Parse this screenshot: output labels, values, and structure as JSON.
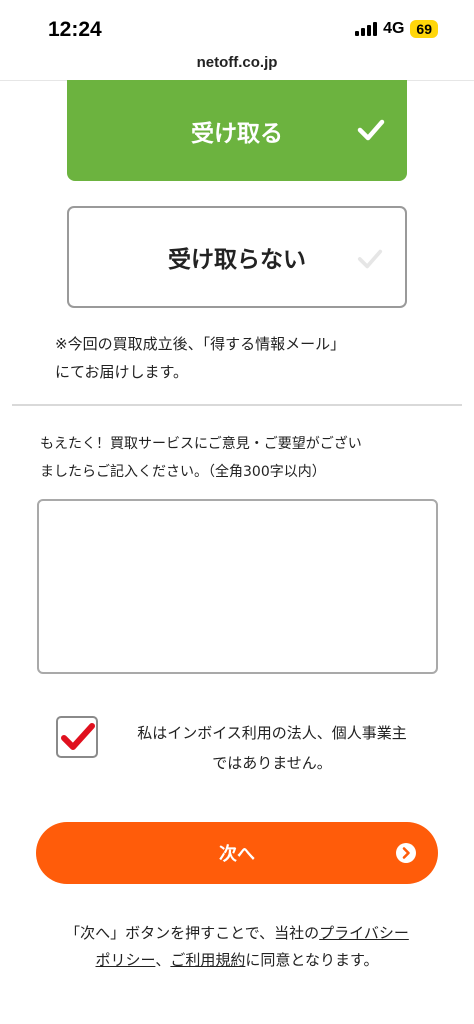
{
  "status_bar": {
    "time": "12:24",
    "network": "4G",
    "battery": "69"
  },
  "browser": {
    "url": "netoff.co.jp"
  },
  "options": {
    "receive_label": "受け取る",
    "decline_label": "受け取らない",
    "note_line1": "※今回の買取成立後、「得する情報メール」",
    "note_line2": "にてお届けします。"
  },
  "comment": {
    "label_line1": "もえたく！買取サービスにご意見・ご要望がござい",
    "label_line2": "ましたらご記入ください。（全角300字以内）",
    "value": ""
  },
  "invoice": {
    "checked": true,
    "label_line1": "私はインボイス利用の法人、個人事業主",
    "label_line2": "ではありません。"
  },
  "next_button": {
    "label": "次へ"
  },
  "consent": {
    "prefix": "「次へ」ボタンを押すことで、当社の",
    "privacy_link_part1": "プライバシー",
    "privacy_link_part2": "ポリシー",
    "separator": "、",
    "terms_link": "ご利用規約",
    "suffix": "に同意となります。"
  },
  "colors": {
    "receive_green": "#6cb33f",
    "next_orange": "#ff5c0a",
    "check_red": "#e0101e",
    "battery_yellow": "#ffd60a"
  }
}
